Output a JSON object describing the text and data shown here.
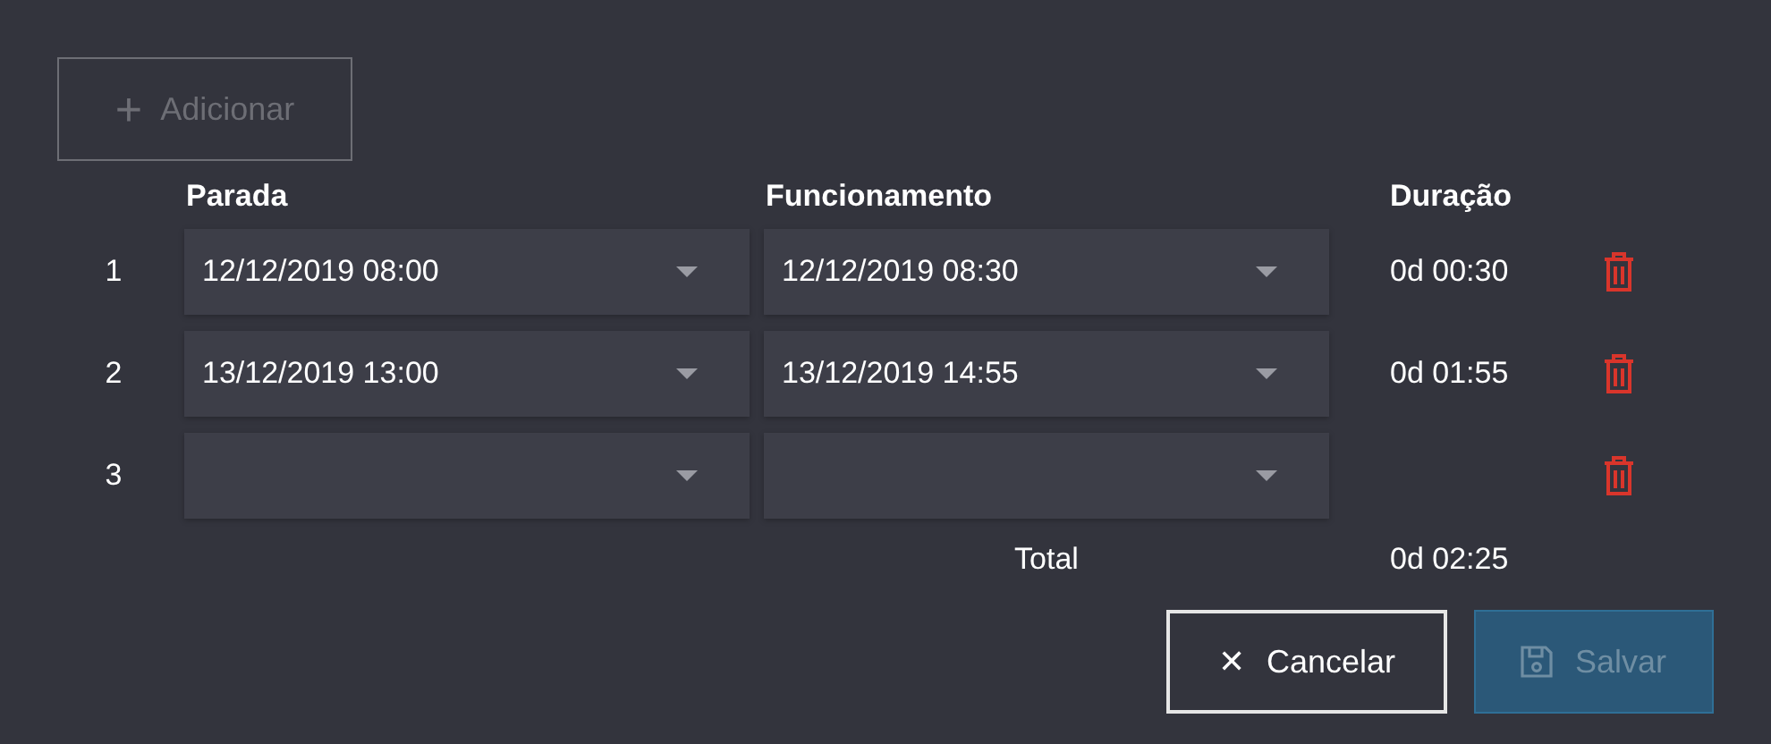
{
  "add_button": {
    "icon": "+",
    "label": "Adicionar",
    "disabled": true
  },
  "columns": [
    "Parada",
    "Funcionamento",
    "Duração"
  ],
  "rows": [
    {
      "index": "1",
      "stop": "12/12/2019 08:00",
      "run": "12/12/2019 08:30",
      "duration": "0d 00:30"
    },
    {
      "index": "2",
      "stop": "13/12/2019 13:00",
      "run": "13/12/2019 14:55",
      "duration": "0d 01:55"
    },
    {
      "index": "3"
    }
  ],
  "total": {
    "label": "Total",
    "value": "0d 02:25"
  },
  "buttons": [
    {
      "kind": "cancel",
      "icon": "✕",
      "label": "Cancelar",
      "disabled": false
    },
    {
      "kind": "save",
      "label": "Salvar",
      "disabled": true
    }
  ]
}
